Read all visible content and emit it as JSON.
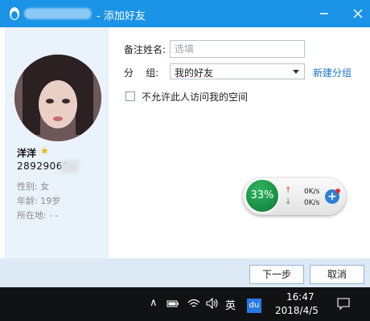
{
  "window": {
    "title": "- 添加好友",
    "minimize_icon": "minimize-icon",
    "close_icon": "close-icon"
  },
  "profile": {
    "nickname": "洋洋",
    "qq_number": "28929065",
    "gender": "性别: 女",
    "age": "年龄: 19岁",
    "location": "所在地:  -     -"
  },
  "form": {
    "remark_label": "备注姓名:",
    "remark_placeholder": "选填",
    "group_label": "分    组:",
    "group_value": "我的好友",
    "new_group_link": "新建分组",
    "privacy_checkbox_label": "不允许此人访问我的空间"
  },
  "footer": {
    "next_label": "下一步",
    "cancel_label": "取消"
  },
  "speed_widget": {
    "percent": "33%",
    "upload": "0K/s",
    "download": "0K/s"
  },
  "taskbar": {
    "ime_label": "英",
    "app_label": "du",
    "time": "16:47",
    "date": "2018/4/5"
  }
}
